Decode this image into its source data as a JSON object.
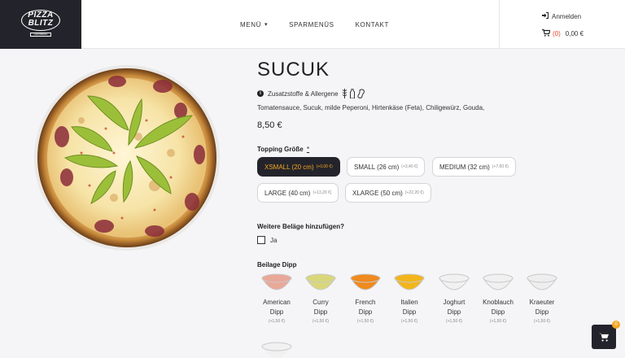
{
  "brand": {
    "line1": "PIZZA",
    "line2": "BLITZ",
    "subline": "GRASBERG"
  },
  "nav": {
    "items": [
      {
        "label": "MENÜ",
        "has_dropdown": true
      },
      {
        "label": "SPARMENÜS"
      },
      {
        "label": "KONTAKT"
      }
    ]
  },
  "account": {
    "login_label": "Anmelden"
  },
  "cart": {
    "count_label": "(0)",
    "total_label": "0,00 €",
    "fab_badge": "0"
  },
  "product": {
    "title": "SUCUK",
    "allergens_label": "Zusatzstoffe & Allergene",
    "ingredients": "Tomatensauce, Sucuk, milde Peperoni, Hirtenkäse (Feta), Chiligewürz, Gouda,",
    "price": "8,50 €"
  },
  "topping_size": {
    "label": "Topping Größe",
    "required_mark": "*",
    "selected_index": 0,
    "options": [
      {
        "label": "XSMALL (20 cm)",
        "extra": "(+0,00 €)"
      },
      {
        "label": "SMALL (26 cm)",
        "extra": "(+3,40 €)"
      },
      {
        "label": "MEDIUM (32 cm)",
        "extra": "(+7,60 €)"
      },
      {
        "label": "LARGE (40 cm)",
        "extra": "(+13,20 €)"
      },
      {
        "label": "XLARGE (50 cm)",
        "extra": "(+22,20 €)"
      }
    ]
  },
  "extra_toppings": {
    "label": "Weitere Beläge hinzufügen?",
    "checkbox_label": "Ja",
    "checked": false
  },
  "dips": {
    "label": "Beilage Dipp",
    "items": [
      {
        "line1": "American",
        "line2": "Dipp",
        "price": "(+1,50 €)",
        "color": "#e9a898"
      },
      {
        "line1": "Curry",
        "line2": "Dipp",
        "price": "(+1,50 €)",
        "color": "#d9d77a"
      },
      {
        "line1": "French",
        "line2": "Dipp",
        "price": "(+1,50 €)",
        "color": "#ef8a1e"
      },
      {
        "line1": "Italien",
        "line2": "Dipp",
        "price": "(+1,50 €)",
        "color": "#f2b51c"
      },
      {
        "line1": "Joghurt",
        "line2": "Dipp",
        "price": "(+1,50 €)",
        "color": "#f1f1f1"
      },
      {
        "line1": "Knoblauch",
        "line2": "Dipp",
        "price": "(+1,50 €)",
        "color": "#f0f0f0"
      },
      {
        "line1": "Kraeuter",
        "line2": "Dipp",
        "price": "(+1,50 €)",
        "color": "#eeeeee"
      }
    ]
  }
}
